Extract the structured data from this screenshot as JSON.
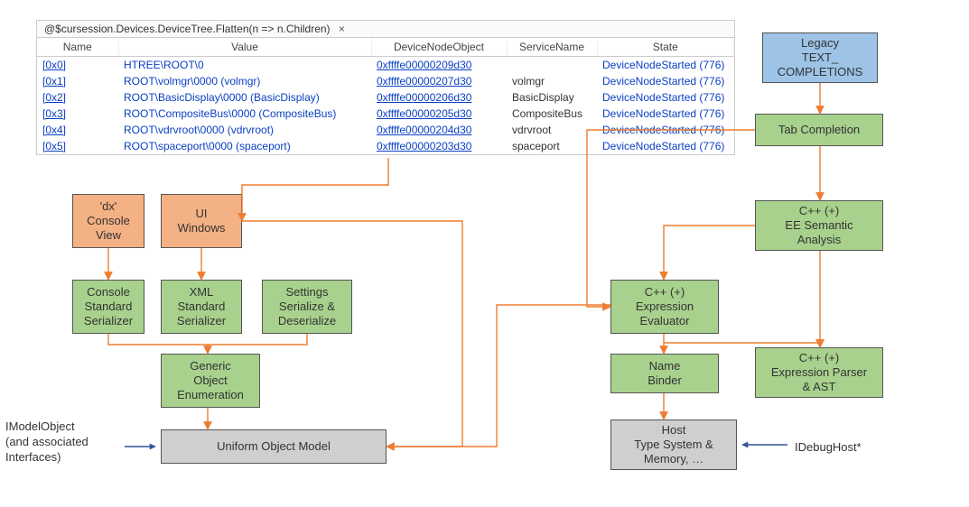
{
  "tab": {
    "title": "@$cursession.Devices.DeviceTree.Flatten(n => n.Children)"
  },
  "table": {
    "headers": [
      "Name",
      "Value",
      "DeviceNodeObject",
      "ServiceName",
      "State"
    ],
    "rows": [
      {
        "name": "[0x0]",
        "value": "HTREE\\ROOT\\0",
        "obj": "0xffffe00000209d30",
        "service": "",
        "state": "DeviceNodeStarted (776)"
      },
      {
        "name": "[0x1]",
        "value": "ROOT\\volmgr\\0000 (volmgr)",
        "obj": "0xffffe00000207d30",
        "service": "volmgr",
        "state": "DeviceNodeStarted (776)"
      },
      {
        "name": "[0x2]",
        "value": "ROOT\\BasicDisplay\\0000 (BasicDisplay)",
        "obj": "0xffffe00000206d30",
        "service": "BasicDisplay",
        "state": "DeviceNodeStarted (776)"
      },
      {
        "name": "[0x3]",
        "value": "ROOT\\CompositeBus\\0000 (CompositeBus)",
        "obj": "0xffffe00000205d30",
        "service": "CompositeBus",
        "state": "DeviceNodeStarted (776)"
      },
      {
        "name": "[0x4]",
        "value": "ROOT\\vdrvroot\\0000 (vdrvroot)",
        "obj": "0xffffe00000204d30",
        "service": "vdrvroot",
        "state": "DeviceNodeStarted (776)"
      },
      {
        "name": "[0x5]",
        "value": "ROOT\\spaceport\\0000 (spaceport)",
        "obj": "0xffffe00000203d30",
        "service": "spaceport",
        "state": "DeviceNodeStarted (776)"
      }
    ]
  },
  "nodes": {
    "dx": "'dx'\nConsole\nView",
    "uiwin": "UI\nWindows",
    "consoleSer": "Console\nStandard\nSerializer",
    "xmlSer": "XML\nStandard\nSerializer",
    "settings": "Settings\nSerialize &\nDeserialize",
    "genEnum": "Generic\nObject\nEnumeration",
    "uom": "Uniform Object Model",
    "legacy": "Legacy\nTEXT_\nCOMPLETIONS",
    "tabcomp": "Tab Completion",
    "semantic": "C++ (+)\nEE Semantic\nAnalysis",
    "evaluator": "C++ (+)\nExpression\nEvaluator",
    "nameBinder": "Name\nBinder",
    "parser": "C++ (+)\nExpression Parser\n& AST",
    "host": "Host\nType System &\nMemory, …"
  },
  "labels": {
    "left": "IModelObject\n(and associated\nInterfaces)",
    "right": "IDebugHost*"
  }
}
